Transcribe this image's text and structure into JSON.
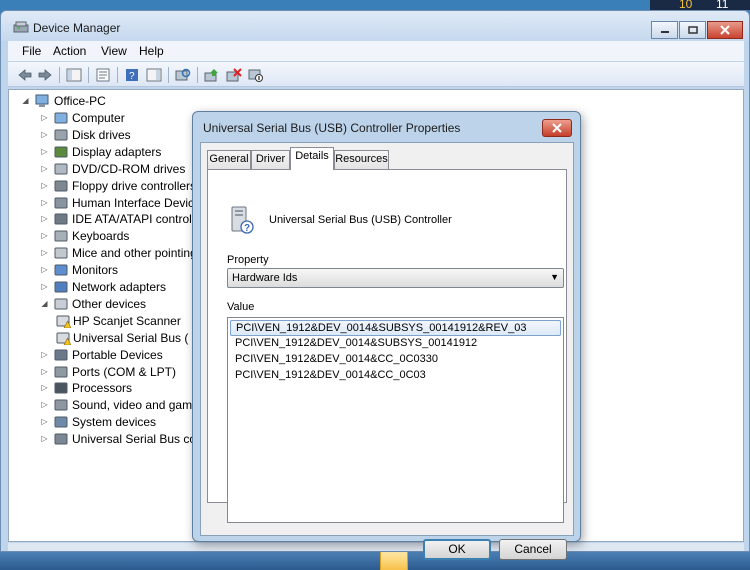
{
  "window": {
    "title": "Device Manager",
    "colors": {
      "titlebar": "#c5d8ee",
      "close": "#c9432f"
    }
  },
  "desktop": {
    "clock_left": "10",
    "clock_right": "11"
  },
  "menu": [
    "File",
    "Action",
    "View",
    "Help"
  ],
  "toolbar": {
    "icons": [
      "back-arrow-icon",
      "forward-arrow-icon",
      "show-hide-console-tree-icon",
      "properties-icon",
      "help-icon",
      "action-pane-icon",
      "scan-hardware-icon",
      "update-driver-icon",
      "uninstall-icon",
      "disable-device-icon"
    ]
  },
  "tree": {
    "root": "Office-PC",
    "items": [
      {
        "label": "Computer",
        "icon": "computer-icon"
      },
      {
        "label": "Disk drives",
        "icon": "disk-drive-icon"
      },
      {
        "label": "Display adapters",
        "icon": "display-adapter-icon"
      },
      {
        "label": "DVD/CD-ROM drives",
        "icon": "dvd-drive-icon"
      },
      {
        "label": "Floppy drive controllers",
        "icon": "floppy-controller-icon"
      },
      {
        "label": "Human Interface Devices",
        "icon": "hid-icon"
      },
      {
        "label": "IDE ATA/ATAPI controllers",
        "icon": "ide-controller-icon"
      },
      {
        "label": "Keyboards",
        "icon": "keyboard-icon"
      },
      {
        "label": "Mice and other pointing devices",
        "icon": "mouse-icon"
      },
      {
        "label": "Monitors",
        "icon": "monitor-icon"
      },
      {
        "label": "Network adapters",
        "icon": "network-adapter-icon"
      },
      {
        "label": "Other devices",
        "icon": "other-devices-icon",
        "expanded": true
      },
      {
        "label": "HP Scanjet Scanner",
        "icon": "warning-device-icon",
        "child": true
      },
      {
        "label": "Universal Serial Bus (USB) Controller",
        "icon": "warning-device-icon",
        "child": true
      },
      {
        "label": "Portable Devices",
        "icon": "portable-device-icon"
      },
      {
        "label": "Ports (COM & LPT)",
        "icon": "port-icon"
      },
      {
        "label": "Processors",
        "icon": "processor-icon"
      },
      {
        "label": "Sound, video and game controllers",
        "icon": "sound-icon"
      },
      {
        "label": "System devices",
        "icon": "system-device-icon"
      },
      {
        "label": "Universal Serial Bus controllers",
        "icon": "usb-icon"
      }
    ]
  },
  "dialog": {
    "title": "Universal Serial Bus (USB) Controller Properties",
    "tabs": [
      "General",
      "Driver",
      "Details",
      "Resources"
    ],
    "active_tab": "Details",
    "device_name": "Universal Serial Bus (USB) Controller",
    "property_label": "Property",
    "property_value": "Hardware Ids",
    "value_label": "Value",
    "values": [
      "PCI\\VEN_1912&DEV_0014&SUBSYS_00141912&REV_03",
      "PCI\\VEN_1912&DEV_0014&SUBSYS_00141912",
      "PCI\\VEN_1912&DEV_0014&CC_0C0330",
      "PCI\\VEN_1912&DEV_0014&CC_0C03"
    ],
    "ok_label": "OK",
    "cancel_label": "Cancel"
  }
}
